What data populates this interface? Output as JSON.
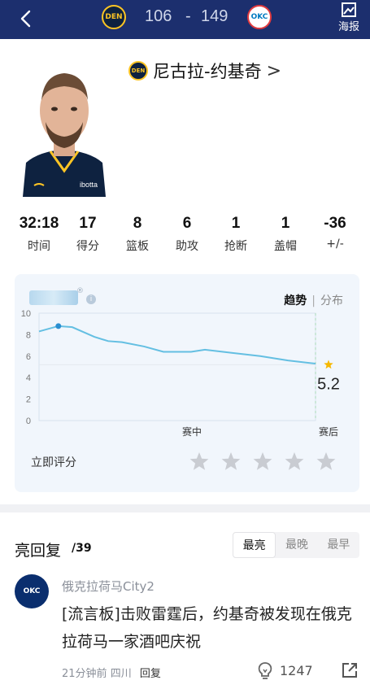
{
  "header": {
    "home_team": "DEN",
    "away_team": "OKC",
    "home_score": "106",
    "separator": "-",
    "away_score": "149",
    "poster_label": "海报",
    "icons": [
      "back-arrow-icon",
      "poster-icon"
    ]
  },
  "player": {
    "team_logo_text": "DEN",
    "name": "尼古拉-约基奇",
    "chevron": ">",
    "jersey_text": "ibotta"
  },
  "stats": [
    {
      "value": "32:18",
      "label": "时间"
    },
    {
      "value": "17",
      "label": "得分"
    },
    {
      "value": "8",
      "label": "篮板"
    },
    {
      "value": "6",
      "label": "助攻"
    },
    {
      "value": "1",
      "label": "抢断"
    },
    {
      "value": "1",
      "label": "盖帽"
    },
    {
      "value": "-36",
      "label": "+/-"
    }
  ],
  "rating_panel": {
    "reg_mark": "®",
    "info_glyph": "i",
    "tab_active": "趋势",
    "tab_sep": "|",
    "tab_inactive": "分布",
    "rate_label": "立即评分",
    "star_count": 5
  },
  "chart_data": {
    "type": "line",
    "y_ticks": [
      "10",
      "8",
      "6",
      "4",
      "2",
      "0"
    ],
    "ylim": [
      0,
      10
    ],
    "x_labels": [
      "赛中",
      "赛后"
    ],
    "x": [
      0,
      0.07,
      0.12,
      0.2,
      0.25,
      0.3,
      0.38,
      0.45,
      0.55,
      0.6,
      0.7,
      0.8,
      0.9,
      1.0
    ],
    "values": [
      8.3,
      8.8,
      8.7,
      7.8,
      7.4,
      7.3,
      6.9,
      6.4,
      6.4,
      6.6,
      6.3,
      6.0,
      5.6,
      5.3
    ],
    "highlight_index": 1,
    "final_value": "5.2",
    "reference_line": 5.2,
    "colors": {
      "line": "#64bfe2",
      "point": "#2a8fd1",
      "star": "#f6b800",
      "grid": "#d8e2ee"
    }
  },
  "comments": {
    "title": "亮回复",
    "count": "/39",
    "sort_options": [
      "最亮",
      "最晚",
      "最早"
    ],
    "active_sort": 0,
    "items": [
      {
        "avatar_text": "OKC",
        "username": "俄克拉荷马City2",
        "text": "[流言板]击败雷霆后，约基奇被发现在俄克拉荷马一家酒吧庆祝",
        "time": "21分钟前",
        "location": "四川",
        "reply_label": "回复",
        "likes": "1247"
      }
    ]
  },
  "colors": {
    "header_bg": "#1c2f6e",
    "panel_bg": "#f1f6fc",
    "accent": "#64bfe2"
  }
}
